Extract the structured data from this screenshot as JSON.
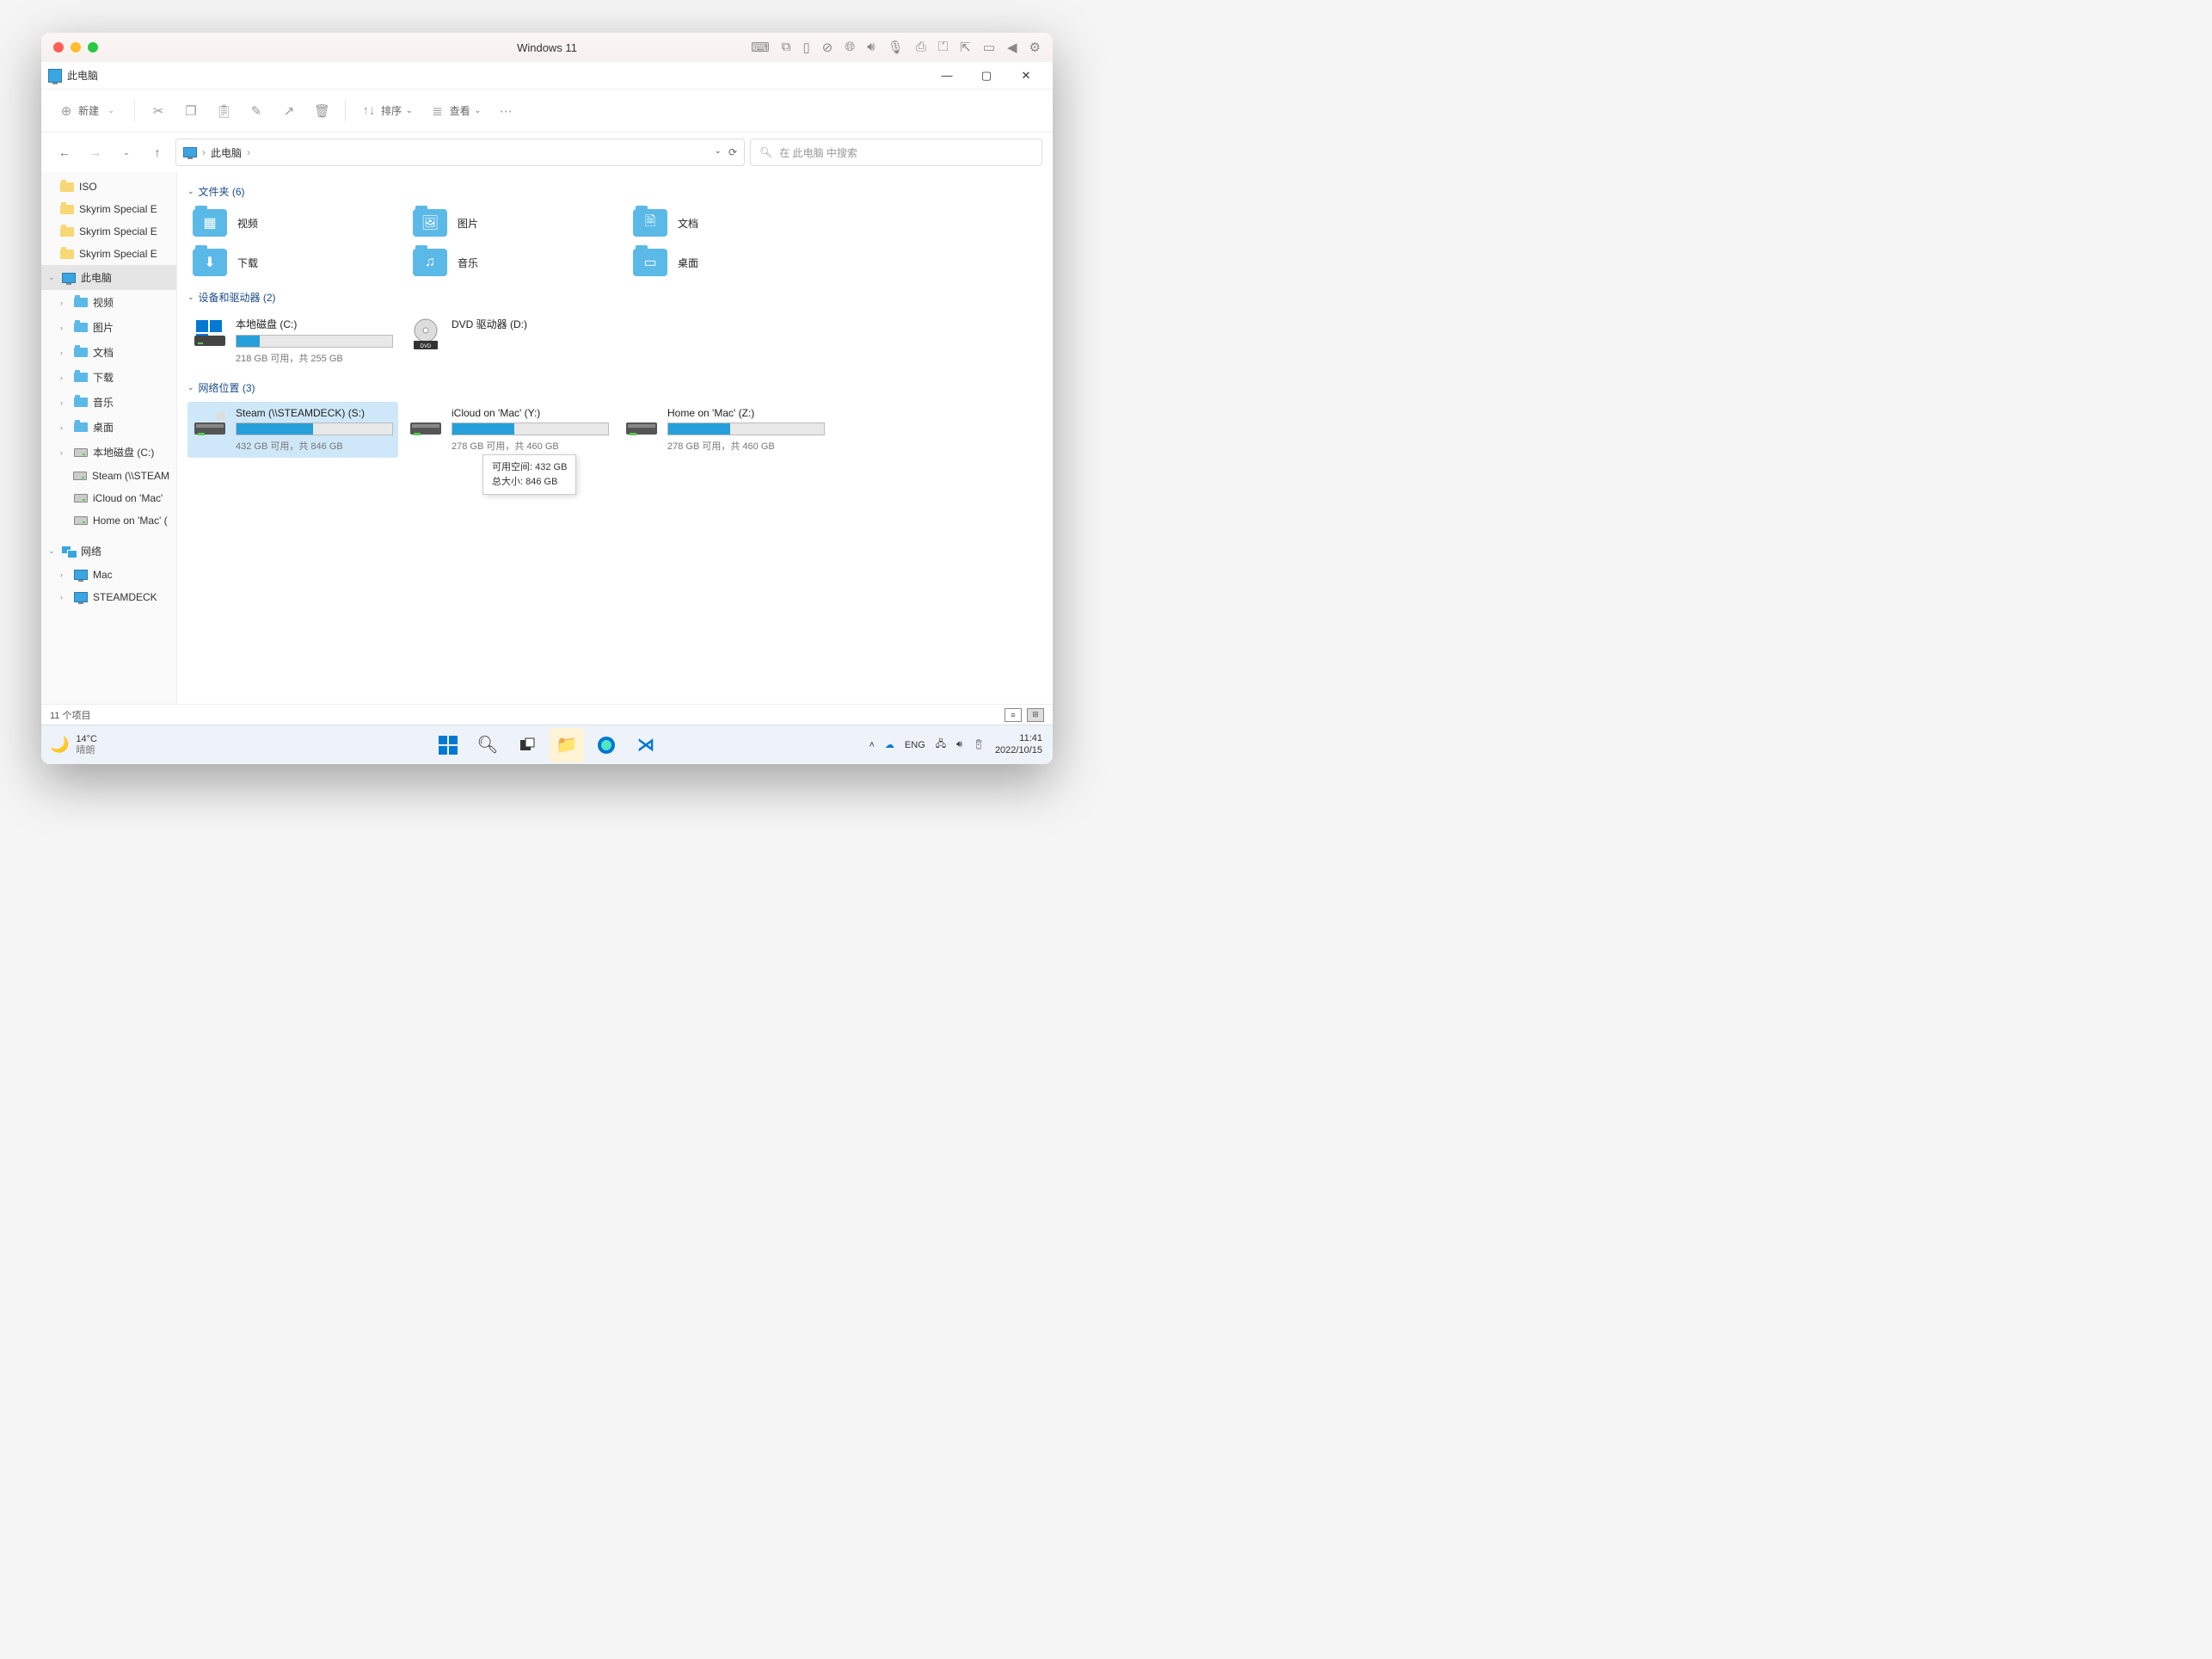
{
  "mac": {
    "title": "Windows 11",
    "right_icons": [
      "keyboard",
      "dock",
      "phone",
      "no-entry",
      "globe",
      "volume",
      "mic",
      "printer",
      "camera",
      "export",
      "window",
      "back",
      "gear"
    ]
  },
  "explorer": {
    "title": "此电脑",
    "toolbar": {
      "new": "新建",
      "sort": "排序",
      "view": "查看"
    },
    "breadcrumb": [
      "此电脑"
    ],
    "search_placeholder": "在 此电脑 中搜索",
    "sidebar": {
      "quick": [
        {
          "label": "ISO"
        },
        {
          "label": "Skyrim Special E"
        },
        {
          "label": "Skyrim Special E"
        },
        {
          "label": "Skyrim Special E"
        }
      ],
      "thispc": {
        "label": "此电脑",
        "children": [
          {
            "label": "视频"
          },
          {
            "label": "图片"
          },
          {
            "label": "文档"
          },
          {
            "label": "下载"
          },
          {
            "label": "音乐"
          },
          {
            "label": "桌面"
          },
          {
            "label": "本地磁盘 (C:)"
          },
          {
            "label": "Steam (\\\\STEAM"
          },
          {
            "label": "iCloud on 'Mac'"
          },
          {
            "label": "Home on 'Mac' ("
          }
        ]
      },
      "network": {
        "label": "网络",
        "children": [
          {
            "label": "Mac"
          },
          {
            "label": "STEAMDECK"
          }
        ]
      }
    },
    "sections": {
      "folders": {
        "title": "文件夹 (6)",
        "items": [
          {
            "name": "视频",
            "icon": "video"
          },
          {
            "name": "图片",
            "icon": "image"
          },
          {
            "name": "文档",
            "icon": "document"
          },
          {
            "name": "下载",
            "icon": "download"
          },
          {
            "name": "音乐",
            "icon": "music"
          },
          {
            "name": "桌面",
            "icon": "desktop"
          }
        ]
      },
      "drives": {
        "title": "设备和驱动器 (2)",
        "items": [
          {
            "name": "本地磁盘 (C:)",
            "sub": "218 GB 可用，共 255 GB",
            "fill": 15,
            "icon": "windows-drive"
          },
          {
            "name": "DVD 驱动器 (D:)",
            "sub": "",
            "fill": null,
            "icon": "dvd"
          }
        ]
      },
      "network": {
        "title": "网络位置 (3)",
        "items": [
          {
            "name": "Steam (\\\\STEAMDECK) (S:)",
            "sub": "432 GB 可用，共 846 GB",
            "fill": 49,
            "selected": true
          },
          {
            "name": "iCloud on 'Mac' (Y:)",
            "sub": "278 GB 可用，共 460 GB",
            "fill": 40
          },
          {
            "name": "Home on 'Mac' (Z:)",
            "sub": "278 GB 可用，共 460 GB",
            "fill": 40
          }
        ]
      }
    },
    "tooltip": {
      "line1": "可用空间: 432 GB",
      "line2": "总大小: 846 GB"
    },
    "status": "11 个项目"
  },
  "taskbar": {
    "weather_temp": "14°C",
    "weather_cond": "晴朗",
    "lang": "ENG",
    "time": "11:41",
    "date": "2022/10/15"
  }
}
